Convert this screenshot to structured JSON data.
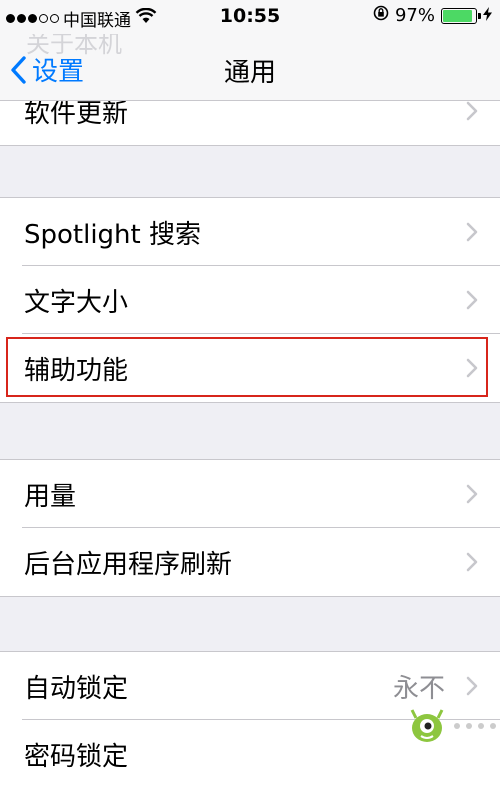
{
  "status_bar": {
    "carrier": "中国联通",
    "time": "10:55",
    "battery_percent": "97%",
    "battery_level": 0.97,
    "signal_bars_filled": 3,
    "signal_bars_total": 5
  },
  "nav": {
    "ghost_title": "关于本机",
    "back_label": "设置",
    "title": "通用"
  },
  "groups": [
    {
      "rows": [
        {
          "label": "软件更新"
        }
      ]
    },
    {
      "rows": [
        {
          "label": "Spotlight 搜索"
        },
        {
          "label": "文字大小"
        },
        {
          "label": "辅助功能",
          "highlighted": true
        }
      ]
    },
    {
      "rows": [
        {
          "label": "用量"
        },
        {
          "label": "后台应用程序刷新"
        }
      ]
    },
    {
      "rows": [
        {
          "label": "自动锁定",
          "value": "永不"
        },
        {
          "label": "密码锁定"
        }
      ]
    }
  ],
  "colors": {
    "accent": "#007aff",
    "highlight_border": "#d7251b",
    "battery_fill": "#4cd964"
  },
  "icons": [
    "wifi-icon",
    "rotation-lock-icon",
    "battery-icon",
    "charging-bolt-icon",
    "back-chevron-icon",
    "chevron-right-icon"
  ]
}
